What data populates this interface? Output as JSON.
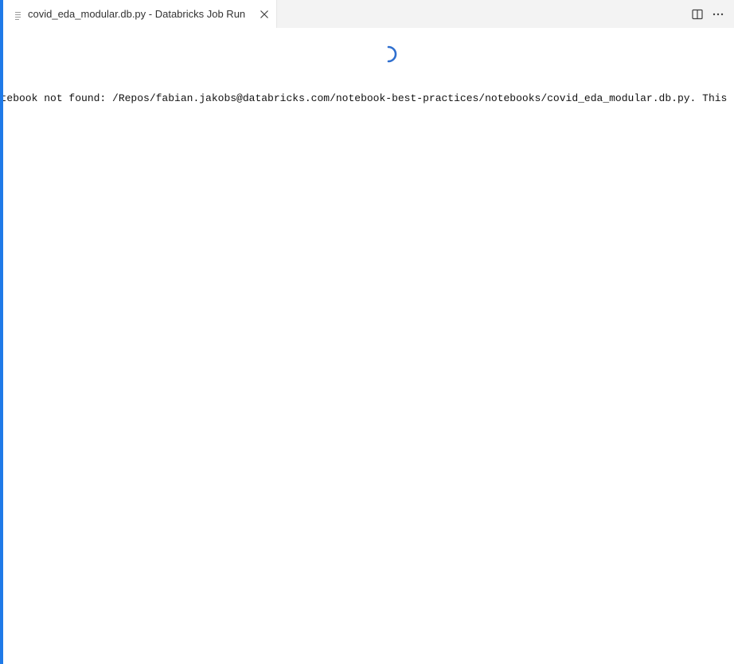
{
  "tab": {
    "title": "covid_eda_modular.db.py - Databricks Job Run",
    "file_icon": "file-lines-icon",
    "close_icon": "close-icon"
  },
  "actions": {
    "split_icon": "split-editor-icon",
    "more_icon": "more-actions-icon"
  },
  "status": {
    "spinner_icon": "loading-spinner-icon",
    "message": "Notebook not found: /Repos/fabian.jakobs@databricks.com/notebook-best-practices/notebooks/covid_eda_modular.db.py. This"
  },
  "colors": {
    "accent": "#1f7ae8",
    "tabbar_bg": "#f3f3f3",
    "spinner": "#2f6fcf"
  }
}
